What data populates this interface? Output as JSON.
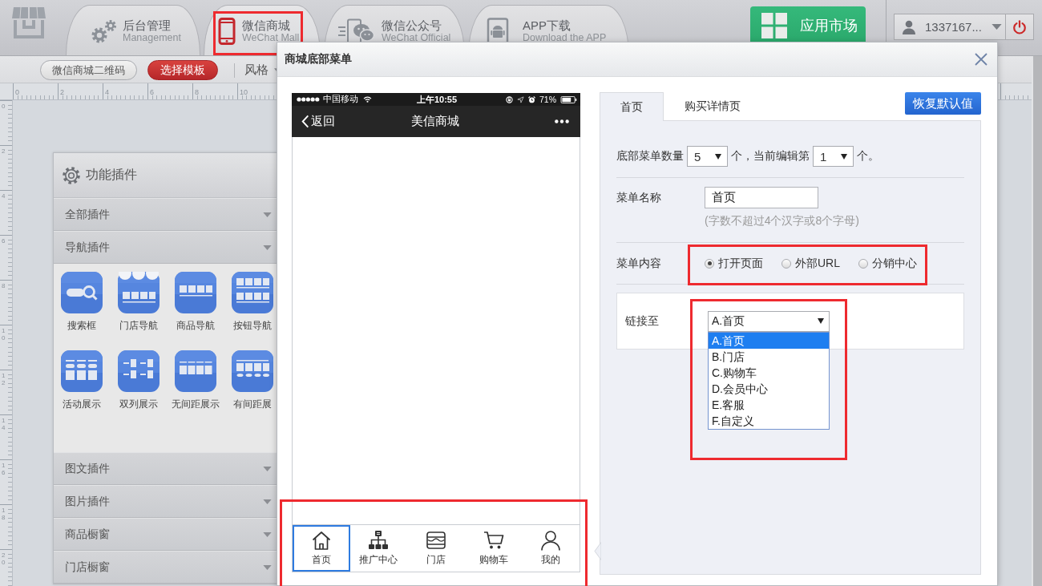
{
  "topbar": {
    "tabs": [
      {
        "title": "后台管理",
        "subtitle": "Management",
        "selected": false,
        "highlighted": false
      },
      {
        "title": "微信商城",
        "subtitle": "WeChat Mall",
        "selected": true,
        "highlighted": true
      },
      {
        "title": "微信公众号",
        "subtitle": "WeChat Official",
        "selected": false,
        "highlighted": false
      },
      {
        "title": "APP下载",
        "subtitle": "Download the APP",
        "selected": false,
        "highlighted": false
      }
    ],
    "market_button": "应用市场",
    "user_menu": "1337167..."
  },
  "toolbar": {
    "buttons": [
      {
        "label": "微信商城二维码",
        "kind": "plain"
      },
      {
        "label": "选择模板",
        "kind": "primary"
      }
    ],
    "style_menu": "风格"
  },
  "rulers": {
    "horizontal": [
      "0",
      "2",
      "4",
      "6",
      "8",
      "10"
    ],
    "vertical": [
      "0",
      "2",
      "4",
      "6",
      "8",
      "10",
      "12",
      "14",
      "16",
      "18",
      "20"
    ]
  },
  "plugin_panel": {
    "title": "功能插件",
    "sections": [
      {
        "label": "全部插件"
      },
      {
        "label": "导航插件",
        "items": [
          "搜索框",
          "门店导航",
          "商品导航",
          "按钮导航",
          "活动展示",
          "双列展示",
          "无间距展示",
          "有间距展"
        ]
      },
      {
        "label": "图文插件"
      },
      {
        "label": "图片插件"
      },
      {
        "label": "商品橱窗"
      },
      {
        "label": "门店橱窗"
      }
    ]
  },
  "modal": {
    "title": "商城底部菜单",
    "phone": {
      "carrier": "中国移动",
      "time": "上午10:55",
      "battery": "71%",
      "back": "返回",
      "page_title": "美信商城",
      "tabbar": {
        "highlighted": true,
        "items": [
          {
            "label": "首页",
            "selected": true
          },
          {
            "label": "推广中心",
            "selected": false
          },
          {
            "label": "门店",
            "selected": false
          },
          {
            "label": "购物车",
            "selected": false
          },
          {
            "label": "我的",
            "selected": false
          }
        ]
      }
    },
    "editor": {
      "tabs": [
        {
          "label": "首页",
          "selected": true
        },
        {
          "label": "购买详情页",
          "selected": false
        }
      ],
      "reset_button": "恢复默认值",
      "count_row": {
        "label": "底部菜单数量",
        "count": "5",
        "between": "个，当前编辑第",
        "current": "1",
        "suffix": "个。"
      },
      "name_row": {
        "label": "菜单名称",
        "value": "首页",
        "hint": "(字数不超过4个汉字或8个字母)"
      },
      "content_row": {
        "label": "菜单内容",
        "highlighted": true,
        "options": [
          {
            "label": "打开页面",
            "selected": true
          },
          {
            "label": "外部URL",
            "selected": false
          },
          {
            "label": "分销中心",
            "selected": false
          }
        ]
      },
      "link_row": {
        "label": "链接至",
        "value": "A.首页",
        "highlighted": true,
        "expanded": true,
        "options": [
          {
            "label": "A.首页",
            "selected": true
          },
          {
            "label": "B.门店",
            "selected": false
          },
          {
            "label": "C.购物车",
            "selected": false
          },
          {
            "label": "D.会员中心",
            "selected": false
          },
          {
            "label": "E.客服",
            "selected": false
          },
          {
            "label": "F.自定义",
            "selected": false
          }
        ]
      }
    }
  }
}
